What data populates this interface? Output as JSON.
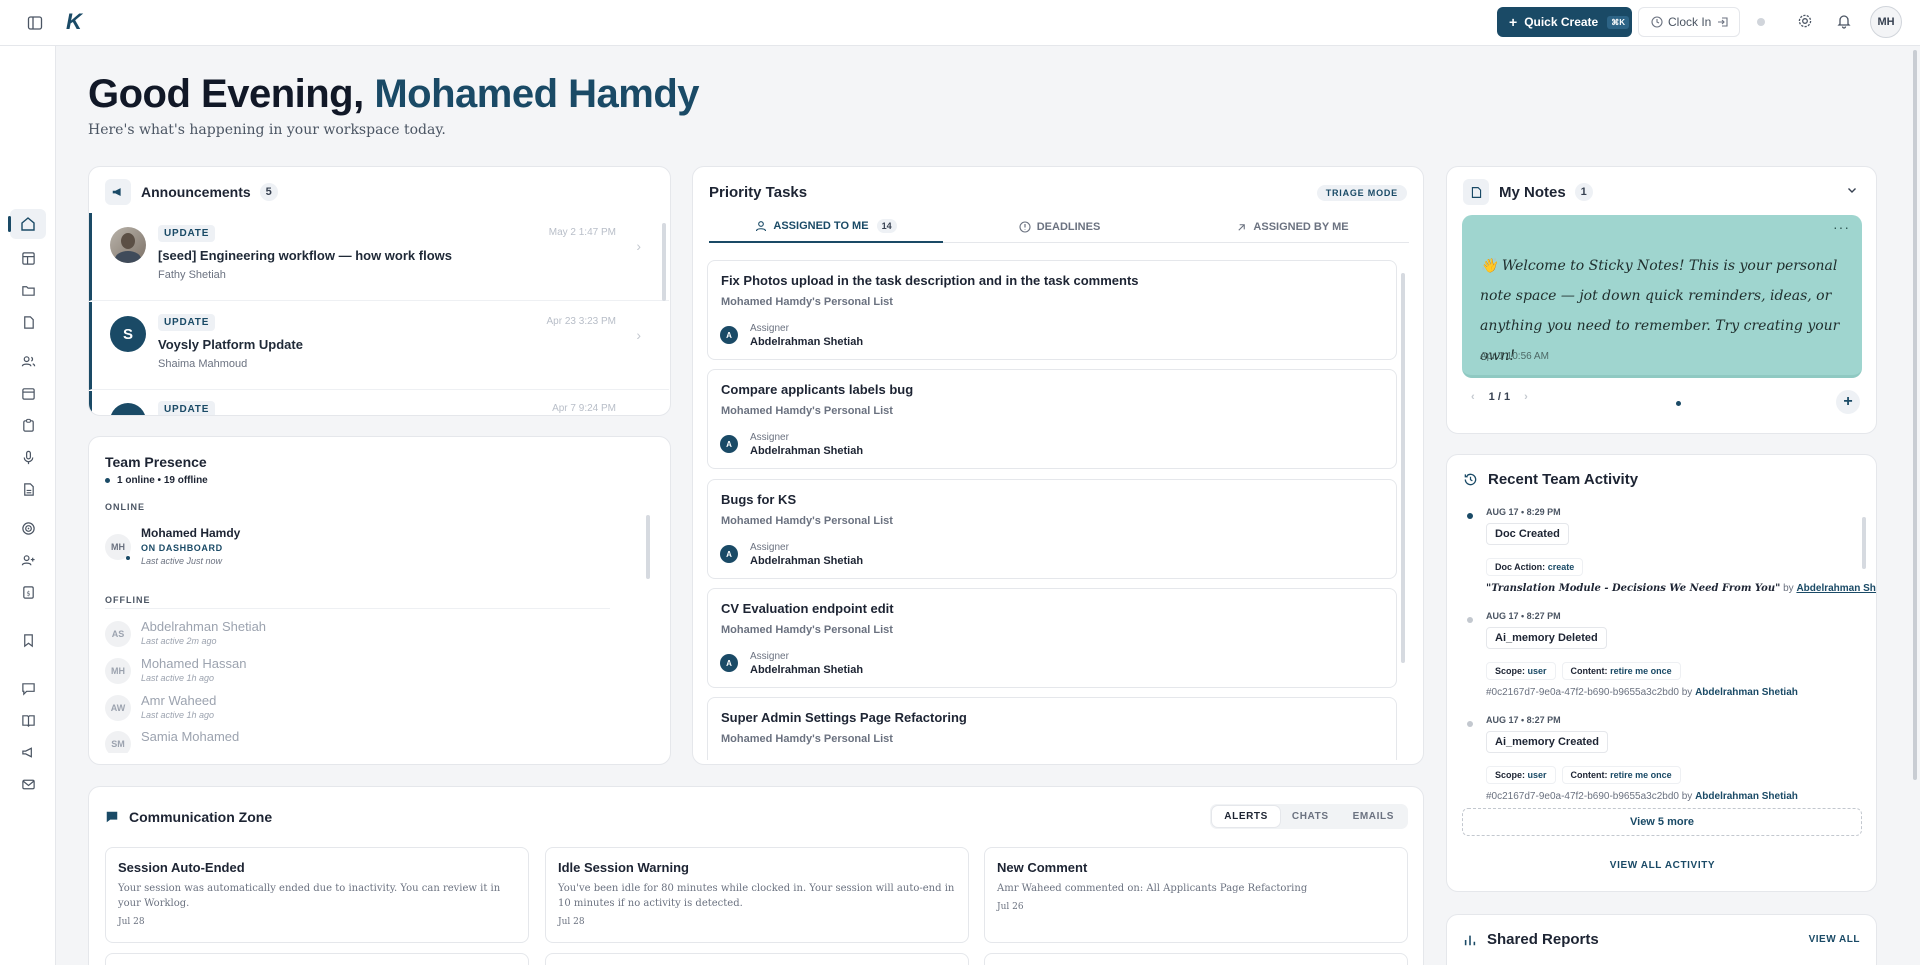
{
  "topbar": {
    "logo": "K",
    "quick_create": "Quick Create",
    "quick_create_shortcut": "⌘K",
    "clock_in": "Clock In",
    "avatar": "MH"
  },
  "greeting": {
    "prefix": "Good Evening,",
    "name": "Mohamed Hamdy",
    "subtitle": "Here's what's happening in your workspace today."
  },
  "announcements": {
    "title": "Announcements",
    "count": "5",
    "items": [
      {
        "tag": "UPDATE",
        "title": "[seed] Engineering workflow — how work flows",
        "author": "Fathy Shetiah",
        "date": "May 2 1:47 PM",
        "avatar": ""
      },
      {
        "tag": "UPDATE",
        "title": "Voysly Platform Update",
        "author": "Shaima Mahmoud",
        "date": "Apr 23 3:23 PM",
        "avatar": "S"
      },
      {
        "tag": "UPDATE",
        "title": "",
        "author": "",
        "date": "Apr 7 9:24 PM",
        "avatar": ""
      }
    ]
  },
  "tasks": {
    "title": "Priority Tasks",
    "mode": "TRIAGE MODE",
    "tabs": [
      {
        "label": "ASSIGNED TO ME",
        "count": "14"
      },
      {
        "label": "DEADLINES"
      },
      {
        "label": "ASSIGNED BY ME"
      }
    ],
    "items": [
      {
        "title": "Fix Photos upload in the task description and in the task comments",
        "list": "Mohamed Hamdy's Personal List",
        "assigner_label": "Assigner",
        "assigner": "Abdelrahman Shetiah",
        "av": "A"
      },
      {
        "title": "Compare applicants labels bug",
        "list": "Mohamed Hamdy's Personal List",
        "assigner_label": "Assigner",
        "assigner": "Abdelrahman Shetiah",
        "av": "A"
      },
      {
        "title": "Bugs for KS",
        "list": "Mohamed Hamdy's Personal List",
        "assigner_label": "Assigner",
        "assigner": "Abdelrahman Shetiah",
        "av": "A"
      },
      {
        "title": "CV Evaluation endpoint edit",
        "list": "Mohamed Hamdy's Personal List",
        "assigner_label": "Assigner",
        "assigner": "Abdelrahman Shetiah",
        "av": "A"
      },
      {
        "title": "Super Admin Settings Page Refactoring",
        "list": "Mohamed Hamdy's Personal List"
      }
    ]
  },
  "notes": {
    "title": "My Notes",
    "count": "1",
    "note_text": "👋 Welcome to Sticky Notes! This is your personal note space — jot down quick reminders, ideas, or anything you need to remember. Try creating your own!",
    "note_date": "Apr 1 10:56 AM",
    "pager": "1 / 1",
    "color": "#9fd5cf"
  },
  "presence": {
    "title": "Team Presence",
    "summary": "1 online • 19 offline",
    "online_label": "ONLINE",
    "offline_label": "OFFLINE",
    "online": [
      {
        "initials": "MH",
        "name": "Mohamed Hamdy",
        "status": "ON DASHBOARD",
        "last": "Last active Just now"
      }
    ],
    "offline": [
      {
        "initials": "AS",
        "name": "Abdelrahman Shetiah",
        "last": "Last active 2m ago"
      },
      {
        "initials": "MH",
        "name": "Mohamed Hassan",
        "last": "Last active 1h ago"
      },
      {
        "initials": "AW",
        "name": "Amr Waheed",
        "last": "Last active 1h ago"
      },
      {
        "initials": "SM",
        "name": "Samia Mohamed",
        "last": ""
      }
    ]
  },
  "activity": {
    "title": "Recent Team Activity",
    "items": [
      {
        "time": "AUG 17 • 8:29 PM",
        "event": "Doc Created",
        "kv": [
          {
            "k": "Doc Action:",
            "v": "create"
          }
        ],
        "line": "\"Translation Module - Decisions We Need From You\"",
        "by": "by",
        "who": "Abdelrahman Shetiah"
      },
      {
        "time": "AUG 17 • 8:27 PM",
        "event": "Ai_memory Deleted",
        "kv": [
          {
            "k": "Scope:",
            "v": "user"
          },
          {
            "k": "Content:",
            "v": "retire me once"
          }
        ],
        "line": "#0c2167d7-9e0a-47f2-b690-b9655a3c2bd0",
        "by": "by",
        "who": "Abdelrahman Shetiah"
      },
      {
        "time": "AUG 17 • 8:27 PM",
        "event": "Ai_memory Created",
        "kv": [
          {
            "k": "Scope:",
            "v": "user"
          },
          {
            "k": "Content:",
            "v": "retire me once"
          }
        ],
        "line": "#0c2167d7-9e0a-47f2-b690-b9655a3c2bd0",
        "by": "by",
        "who": "Abdelrahman Shetiah"
      }
    ],
    "view_more": "View 5 more",
    "view_all": "VIEW ALL ACTIVITY"
  },
  "comm": {
    "title": "Communication Zone",
    "tabs": [
      "ALERTS",
      "CHATS",
      "EMAILS"
    ],
    "items": [
      {
        "title": "Session Auto-Ended",
        "body": "Your session was automatically ended due to inactivity. You can review it in your Worklog.",
        "date": "Jul 28"
      },
      {
        "title": "Idle Session Warning",
        "body": "You've been idle for 80 minutes while clocked in. Your session will auto-end in 10 minutes if no activity is detected.",
        "date": "Jul 28"
      },
      {
        "title": "New Comment",
        "body": "Amr Waheed commented on: All Applicants Page Refactoring",
        "date": "Jul 26"
      }
    ]
  },
  "reports": {
    "title": "Shared Reports",
    "view_all": "VIEW ALL"
  }
}
